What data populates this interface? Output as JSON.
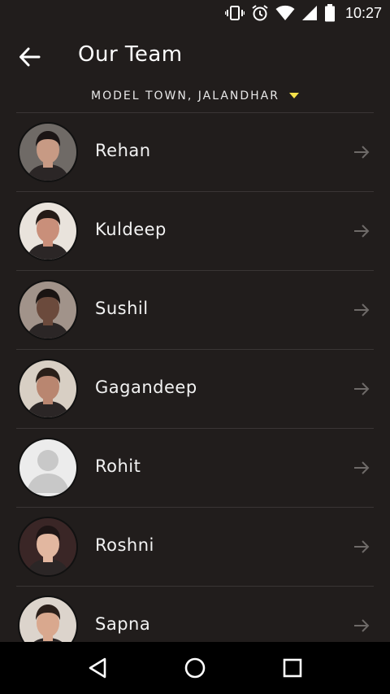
{
  "status_bar": {
    "time": "10:27",
    "icons": [
      "vibrate-icon",
      "alarm-icon",
      "wifi-icon",
      "signal-icon",
      "battery-icon"
    ]
  },
  "header": {
    "title": "Our Team",
    "back_icon": "arrow-left-icon"
  },
  "location": {
    "label": "MODEL TOWN, JALANDHAR",
    "accent_color": "#f5e14a"
  },
  "team": [
    {
      "name": "Rehan",
      "avatar_bg": "#6f6a66",
      "skin": "#c79a84",
      "hair": "#1b1515"
    },
    {
      "name": "Kuldeep",
      "avatar_bg": "#e9e3dc",
      "skin": "#c98f7a",
      "hair": "#241a16"
    },
    {
      "name": "Sushil",
      "avatar_bg": "#a1938a",
      "skin": "#6b4a3c",
      "hair": "#1a1412"
    },
    {
      "name": "Gagandeep",
      "avatar_bg": "#d8cfc4",
      "skin": "#b98670",
      "hair": "#2a1f19"
    },
    {
      "name": "Rohit",
      "avatar_bg": "#ececec",
      "placeholder": true
    },
    {
      "name": "Roshni",
      "avatar_bg": "#3a2626",
      "skin": "#e2b7a0",
      "hair": "#1e1515"
    },
    {
      "name": "Sapna",
      "avatar_bg": "#dcd4cc",
      "skin": "#d9a88e",
      "hair": "#2b1f1a"
    }
  ],
  "nav_bar": {
    "icons": [
      "back-triangle-icon",
      "home-circle-icon",
      "recents-square-icon"
    ]
  },
  "colors": {
    "background": "#211d1c",
    "divider": "#3a3535",
    "arrow": "#6e6a68"
  }
}
